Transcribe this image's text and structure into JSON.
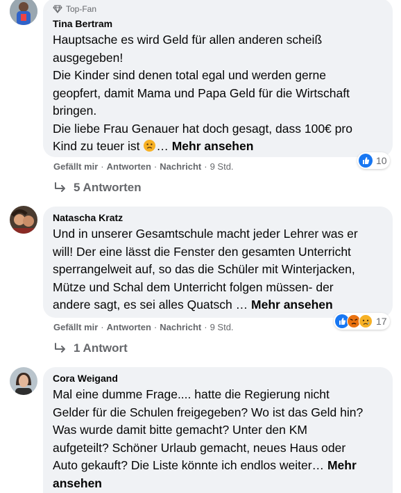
{
  "comments": [
    {
      "badge": "Top-Fan",
      "author": "Tina Bertram",
      "lines": [
        "Hauptsache es wird Geld für allen anderen scheiß",
        "ausgegeben!",
        "Die Kinder sind denen total egal und werden gerne",
        "geopfert, damit Mama und Papa Geld für die Wirtschaft",
        "bringen.",
        "Die liebe Frau Genauer hat doch gesagt, dass 100€ pro"
      ],
      "last_line": "Kind zu teuer ist",
      "ellipsis": "…",
      "more": "Mehr ansehen",
      "actions": {
        "like": "Gefällt mir",
        "reply": "Antworten",
        "message": "Nachricht",
        "time": "9 Std.",
        "dot": "·"
      },
      "reaction_count": "10",
      "reactions": [
        "like"
      ],
      "replies": "5 Antworten"
    },
    {
      "author": "Natascha Kratz",
      "lines": [
        "Und in unserer Gesamtschule macht jeder Lehrer was er",
        "will! Der eine lässt die Fenster den gesamten Unterricht",
        "sperrangelweit auf, so das die Schüler mit Winterjacken,",
        "Mütze und Schal dem Unterricht folgen müssen- der"
      ],
      "last_line": "andere sagt, es sei alles Quatsch",
      "ellipsis": " …",
      "more": "Mehr ansehen",
      "actions": {
        "like": "Gefällt mir",
        "reply": "Antworten",
        "message": "Nachricht",
        "time": "9 Std.",
        "dot": "·"
      },
      "reaction_count": "17",
      "reactions": [
        "like",
        "angry",
        "sad"
      ],
      "replies": "1 Antwort"
    },
    {
      "author": "Cora Weigand",
      "lines": [
        "Mal eine dumme Frage.... hatte die Regierung nicht",
        "Gelder für die Schulen freigegeben? Wo ist das Geld hin?",
        "Was wurde damit bitte gemacht? Unter den KM",
        "aufgeteilt? Schöner Urlaub gemacht, neues Haus oder"
      ],
      "last_line": "Auto gekauft? Die Liste könnte ich endlos weiter…",
      "more_line1": "Mehr",
      "more_line2": "ansehen"
    }
  ],
  "colors": {
    "bubble": "#f0f2f5",
    "like": "#1877f2",
    "secondary": "#65676b"
  }
}
